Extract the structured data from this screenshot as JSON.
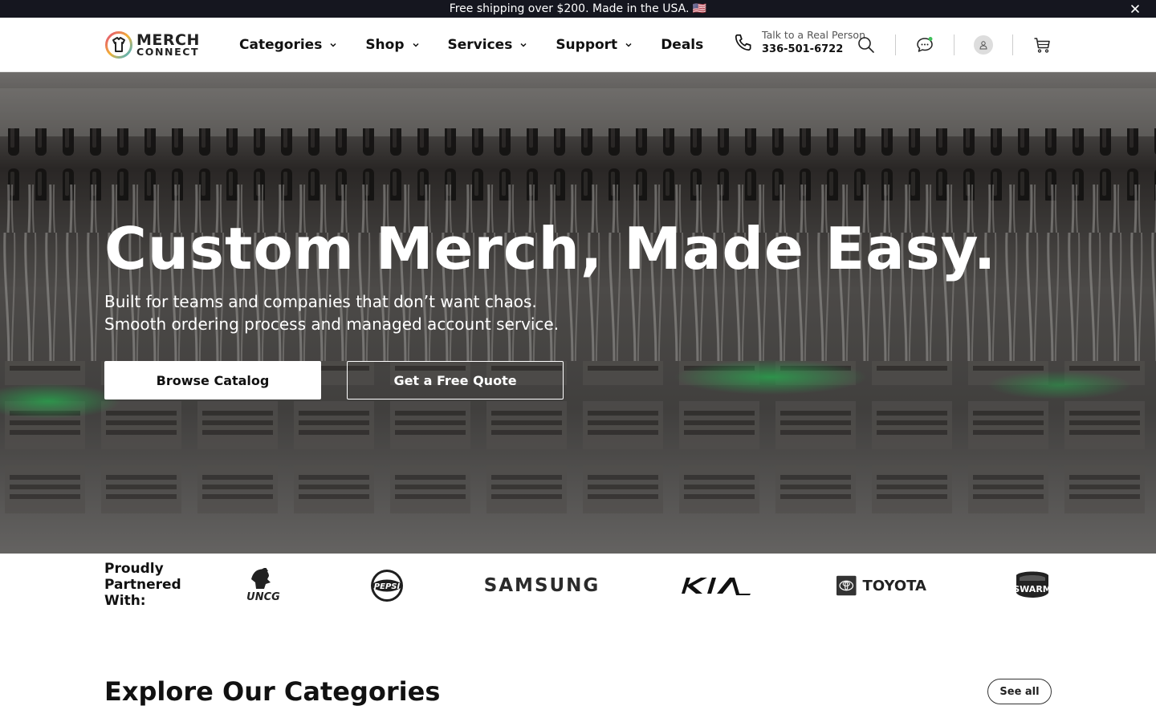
{
  "announcement": {
    "text": "Free shipping over $200. Made in the USA. 🇺🇸",
    "close_icon": "close-icon"
  },
  "header": {
    "logo": {
      "line1": "MERCH",
      "line2": "CONNECT"
    },
    "nav": [
      {
        "label": "Categories",
        "has_dropdown": true
      },
      {
        "label": "Shop",
        "has_dropdown": true
      },
      {
        "label": "Services",
        "has_dropdown": true
      },
      {
        "label": "Support",
        "has_dropdown": true
      },
      {
        "label": "Deals",
        "has_dropdown": false
      }
    ],
    "phone": {
      "label": "Talk to a Real Person",
      "number": "336-501-6722",
      "icon": "phone-icon"
    },
    "icons": [
      "search-icon",
      "chat-icon",
      "account-icon",
      "cart-icon"
    ],
    "chat_badge_color": "#3fbf5a"
  },
  "hero": {
    "title": "Custom Merch, Made Easy.",
    "subtitle_line1": "Built for teams and companies that don’t want chaos.",
    "subtitle_line2": "Smooth ordering process and managed account service.",
    "primary_button": "Browse Catalog",
    "secondary_button": "Get a Free Quote"
  },
  "partners": {
    "label": "Proudly Partnered With:",
    "logos": [
      {
        "name": "UNCG",
        "text": "UNCG"
      },
      {
        "name": "Pepsi",
        "text": "PEPSI"
      },
      {
        "name": "Samsung",
        "text": "SAMSUNG"
      },
      {
        "name": "Kia",
        "text": "KIA"
      },
      {
        "name": "Toyota",
        "text": "TOYOTA"
      },
      {
        "name": "Greensboro Swarm",
        "text": "SWARM"
      }
    ]
  },
  "explore": {
    "title": "Explore Our Categories",
    "see_all": "See all"
  },
  "colors": {
    "announcement_bg": "#15161f",
    "text": "#111111",
    "button_primary_bg": "#ffffff"
  }
}
